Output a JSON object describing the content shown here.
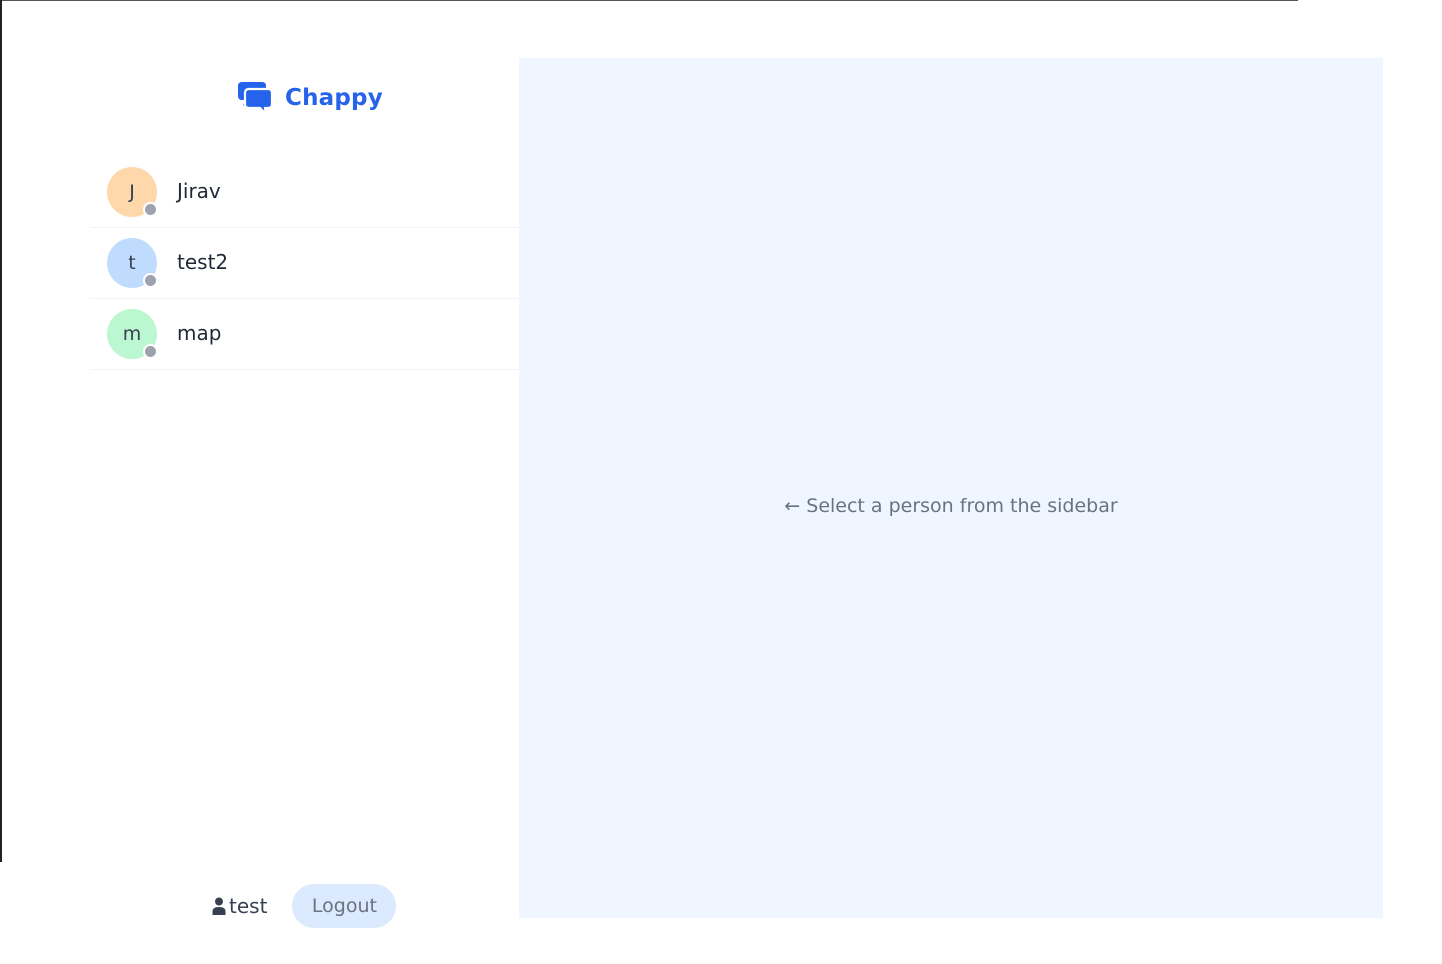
{
  "brand": {
    "name": "Chappy",
    "color": "#2563eb"
  },
  "contacts": [
    {
      "initial": "J",
      "name": "Jirav",
      "avatar_color": "#fed7aa",
      "status": "offline"
    },
    {
      "initial": "t",
      "name": "test2",
      "avatar_color": "#bfdbfe",
      "status": "offline"
    },
    {
      "initial": "m",
      "name": "map",
      "avatar_color": "#bbf7d0",
      "status": "offline"
    }
  ],
  "user": {
    "username": "test",
    "icon": "user-icon",
    "logout_label": "Logout"
  },
  "main": {
    "placeholder": "← Select a person from the sidebar",
    "background": "#eff6ff"
  },
  "colors": {
    "status_offline": "#9ca3af",
    "logout_bg": "#dbeafe"
  }
}
